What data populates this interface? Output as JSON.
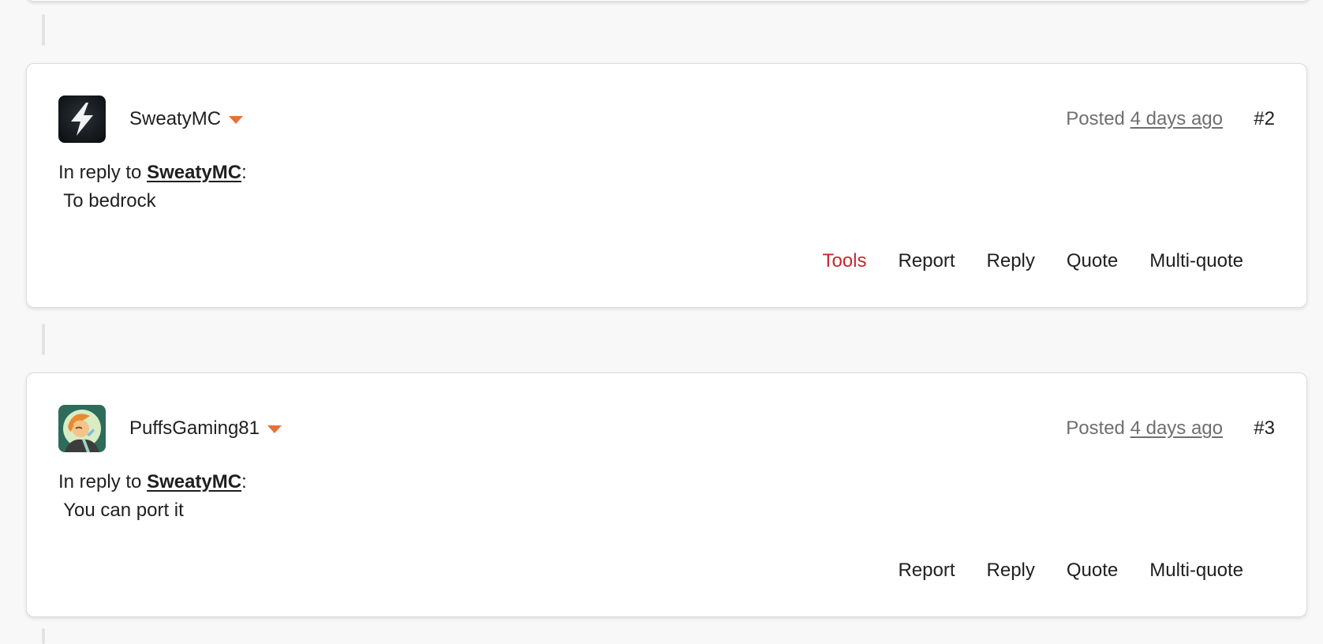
{
  "posts": [
    {
      "username": "SweatyMC",
      "posted_prefix": "Posted",
      "posted_ago": "4 days ago",
      "post_number": "#2",
      "reply_prefix": "In reply to",
      "reply_to": "SweatyMC",
      "reply_suffix": ":",
      "body": "To bedrock",
      "avatar_icon": "lightning-bolt-icon",
      "actions": {
        "tools": "Tools",
        "report": "Report",
        "reply": "Reply",
        "quote": "Quote",
        "multiquote": "Multi-quote"
      }
    },
    {
      "username": "PuffsGaming81",
      "posted_prefix": "Posted",
      "posted_ago": "4 days ago",
      "post_number": "#3",
      "reply_prefix": "In reply to",
      "reply_to": "SweatyMC",
      "reply_suffix": ":",
      "body": "You can port it",
      "avatar_icon": "cartoon-character-avatar",
      "actions": {
        "report": "Report",
        "reply": "Reply",
        "quote": "Quote",
        "multiquote": "Multi-quote"
      }
    }
  ],
  "colors": {
    "accent_caret": "#e8703a",
    "tools_link": "#c8262c",
    "muted_text": "#6f6f6f",
    "page_background": "#f8f8f8"
  }
}
